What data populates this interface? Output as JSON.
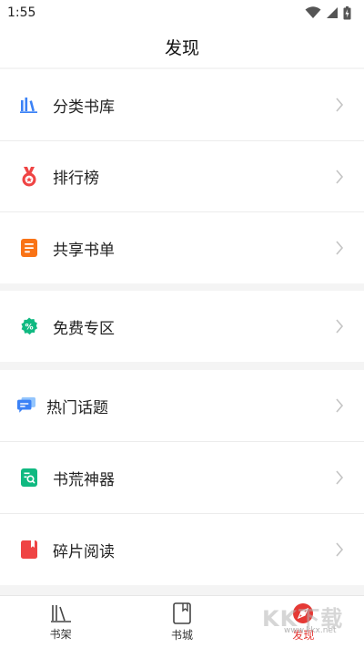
{
  "status_bar": {
    "time": "1:55"
  },
  "header": {
    "title": "发现"
  },
  "sections": [
    {
      "items": [
        {
          "label": "分类书库",
          "icon": "bookshelf-icon",
          "color": "#3b82f6"
        },
        {
          "label": "排行榜",
          "icon": "medal-icon",
          "color": "#ef4444"
        },
        {
          "label": "共享书单",
          "icon": "list-doc-icon",
          "color": "#f97316"
        }
      ]
    },
    {
      "items": [
        {
          "label": "免费专区",
          "icon": "discount-badge-icon",
          "color": "#10b981"
        }
      ]
    },
    {
      "items": [
        {
          "label": "热门话题",
          "icon": "chat-bubbles-icon",
          "color": "#3b82f6"
        },
        {
          "label": "书荒神器",
          "icon": "book-search-icon",
          "color": "#10b981"
        },
        {
          "label": "碎片阅读",
          "icon": "red-book-icon",
          "color": "#ef4444"
        }
      ]
    }
  ],
  "tabbar": {
    "tabs": [
      {
        "label": "书架",
        "icon": "bookshelf-tab-icon"
      },
      {
        "label": "书城",
        "icon": "book-tab-icon"
      },
      {
        "label": "发现",
        "icon": "discover-tab-icon",
        "active": true
      }
    ]
  },
  "watermark": {
    "text": "KK下载",
    "url": "www.kkx.net"
  }
}
